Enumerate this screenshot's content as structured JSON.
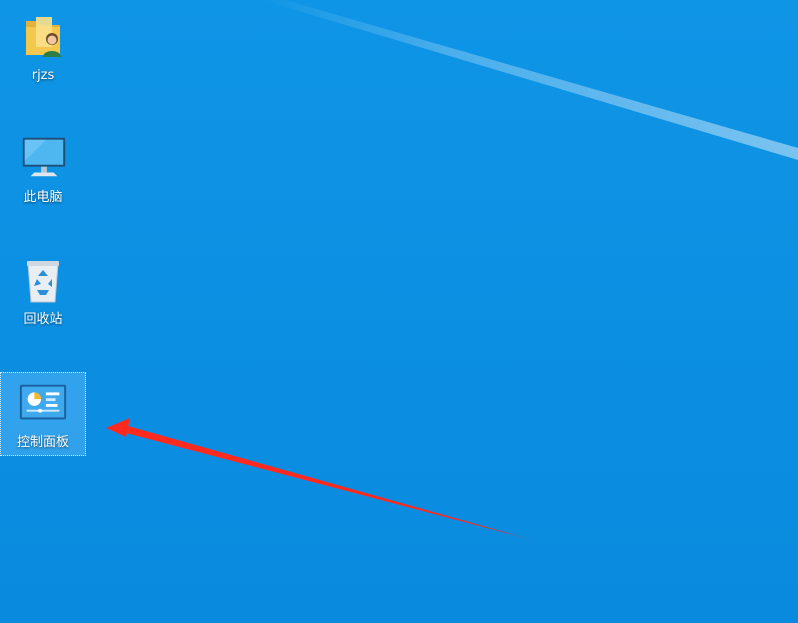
{
  "desktop": {
    "background_color": "#0b8fe2",
    "icons": [
      {
        "label": "rjzs",
        "icon": "user-folder-icon"
      },
      {
        "label": "此电脑",
        "icon": "computer-icon"
      },
      {
        "label": "回收站",
        "icon": "recycle-bin-icon"
      },
      {
        "label": "控制面板",
        "icon": "control-panel-icon",
        "selected": true
      }
    ]
  },
  "annotation": {
    "arrow_color": "#ff2a1f"
  }
}
